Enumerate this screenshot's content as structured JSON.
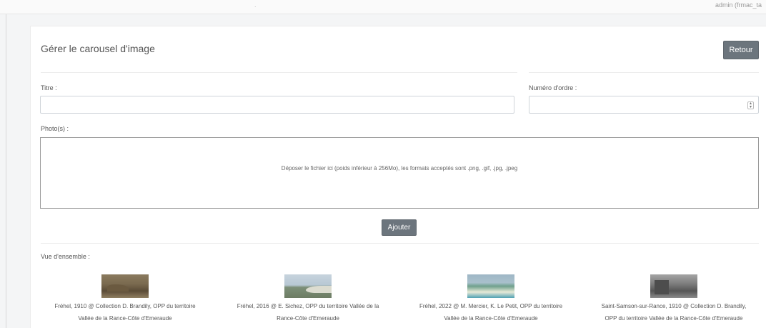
{
  "header": {
    "user_text": "admin (frmac_ta",
    "fragment_text": "."
  },
  "page": {
    "title": "Gérer le carousel d'image",
    "back_label": "Retour"
  },
  "form": {
    "title_label": "Titre :",
    "title_value": "",
    "order_label": "Numéro d'ordre :",
    "order_value": "",
    "photos_label": "Photo(s) :",
    "dropzone_text": "Déposer le fichier ici (poids inférieur à 256Mo), les formats acceptés sont .png, .gif, .jpg, .jpeg",
    "add_label": "Ajouter"
  },
  "overview": {
    "label": "Vue d'ensemble :",
    "items": [
      {
        "caption_line1": "Fréhel, 1910 @ Collection D. Brandily, OPP du territoire",
        "caption_line2": "Vallée de la Rance-Côte d'Emeraude"
      },
      {
        "caption_line1": "Fréhel, 2016 @ E. Sichez, OPP du territoire Vallée de la",
        "caption_line2": "Rance-Côte d'Emeraude"
      },
      {
        "caption_line1": "Fréhel, 2022 @ M. Mercier, K. Le Petit, OPP du territoire",
        "caption_line2": "Vallée de la Rance-Côte d'Emeraude"
      },
      {
        "caption_line1": "Saint-Samson-sur-Rance, 1910 @ Collection D. Brandily,",
        "caption_line2": "OPP du territoire Vallée de la Rance-Côte d'Emeraude"
      }
    ]
  },
  "colors": {
    "button": "#6c757d",
    "background": "#f4f5f6"
  }
}
